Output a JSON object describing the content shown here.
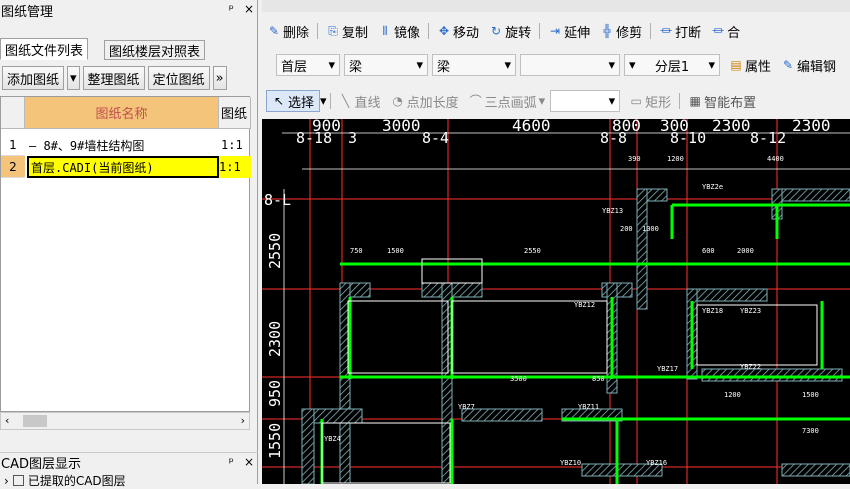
{
  "left_panel": {
    "title": "图纸管理",
    "pin": "ᵖ",
    "close": "×",
    "tabs": [
      "图纸文件列表",
      "图纸楼层对照表"
    ],
    "buttons": {
      "add": "添加图纸",
      "arrange": "整理图纸",
      "locate": "定位图纸",
      "more": "»"
    },
    "table": {
      "headers": [
        "图纸名称",
        "图纸"
      ],
      "rows": [
        {
          "num": "1",
          "name": "— 8#、9#墙柱结构图",
          "scale": "1:1"
        },
        {
          "num": "2",
          "name": "首层.CADI(当前图纸)",
          "scale": "1:1"
        }
      ]
    },
    "cad_title": "CAD图层显示",
    "cad_item": "已提取的CAD图层"
  },
  "toolbar1": {
    "items": [
      "删除",
      "复制",
      "镜像",
      "移动",
      "旋转",
      "延伸",
      "修剪",
      "打断",
      "合"
    ]
  },
  "toolbar2": {
    "floor": "首层",
    "type1": "梁",
    "type2": "梁",
    "blank": "",
    "layer": "分层1",
    "props": "属性",
    "edit": "编辑钢"
  },
  "toolbar3": {
    "select": "选择",
    "line": "直线",
    "point_len": "点加长度",
    "arc": "三点画弧",
    "rect": "矩形",
    "smart": "智能布置"
  },
  "canvas": {
    "top_dims": [
      "900",
      "3000",
      "4600",
      "800",
      "300",
      "2300",
      "2300"
    ],
    "axes": [
      "8-18",
      "3",
      "8-4",
      "8-8",
      "8-10",
      "8-12"
    ],
    "left_dims": [
      "8-L",
      "2550",
      "2300",
      "950",
      "1550"
    ],
    "small_labels": [
      "390",
      "1200",
      "4400",
      "200",
      "1000",
      "750",
      "1500",
      "YBZ13",
      "YBZ2e",
      "YBZ12",
      "YBZ11",
      "YBZ7",
      "YBZ17",
      "YBZ18",
      "YBZ22",
      "YBZ23",
      "YBZ4",
      "YBZ10",
      "YBZ16",
      "7300",
      "1200",
      "1500",
      "2550",
      "3500",
      "850",
      "600",
      "2000"
    ]
  },
  "colors": {
    "grid_line": "#ff3030",
    "wall": "#00ff00",
    "hatch": "#6b9aa0",
    "text": "#ffffff",
    "header_bg": "#f3c47a",
    "selected_row": "#ffff00"
  }
}
